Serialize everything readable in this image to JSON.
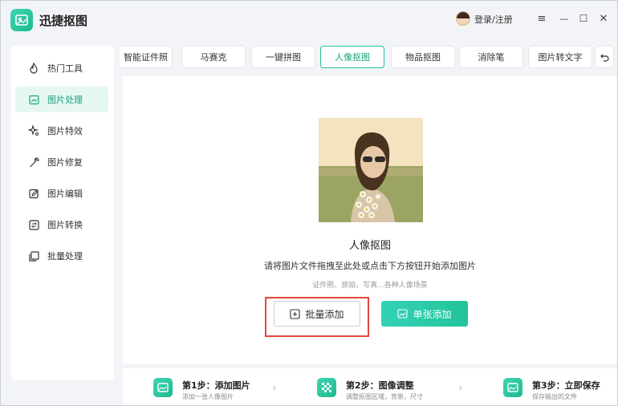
{
  "app": {
    "title": "迅捷抠图"
  },
  "header": {
    "login_label": "登录/注册"
  },
  "window_controls": {
    "menu": "≡",
    "minimize": "—",
    "maximize": "☐",
    "close": "✕"
  },
  "sidebar": {
    "items": [
      {
        "label": "热门工具",
        "icon": "flame-icon",
        "active": false
      },
      {
        "label": "图片处理",
        "icon": "image-edit-icon",
        "active": true
      },
      {
        "label": "图片特效",
        "icon": "sparkle-icon",
        "active": false
      },
      {
        "label": "图片修复",
        "icon": "wrench-icon",
        "active": false
      },
      {
        "label": "图片编辑",
        "icon": "pencil-box-icon",
        "active": false
      },
      {
        "label": "图片转换",
        "icon": "convert-icon",
        "active": false
      },
      {
        "label": "批量处理",
        "icon": "stack-icon",
        "active": false
      }
    ]
  },
  "tabs": [
    {
      "label": "智能证件照",
      "active": false
    },
    {
      "label": "马赛克",
      "active": false
    },
    {
      "label": "一键拼图",
      "active": false
    },
    {
      "label": "人像抠图",
      "active": true
    },
    {
      "label": "物品抠图",
      "active": false
    },
    {
      "label": "消除笔",
      "active": false
    },
    {
      "label": "图片转文字",
      "active": false
    }
  ],
  "main": {
    "title": "人像抠图",
    "description": "请将图片文件拖拽至此处或点击下方按钮开始添加图片",
    "hint": "证件照、旅拍、写真...各种人像场景",
    "batch_button": "批量添加",
    "single_button": "单张添加"
  },
  "steps": [
    {
      "title": "第1步：添加图片",
      "desc": "添加一张人像图片"
    },
    {
      "title": "第2步：图像调整",
      "desc": "调整抠图区域，背景，尺寸"
    },
    {
      "title": "第3步：立即保存",
      "desc": "保存输出的文件"
    }
  ],
  "colors": {
    "accent": "#22c49a",
    "highlight": "#e6463c"
  }
}
